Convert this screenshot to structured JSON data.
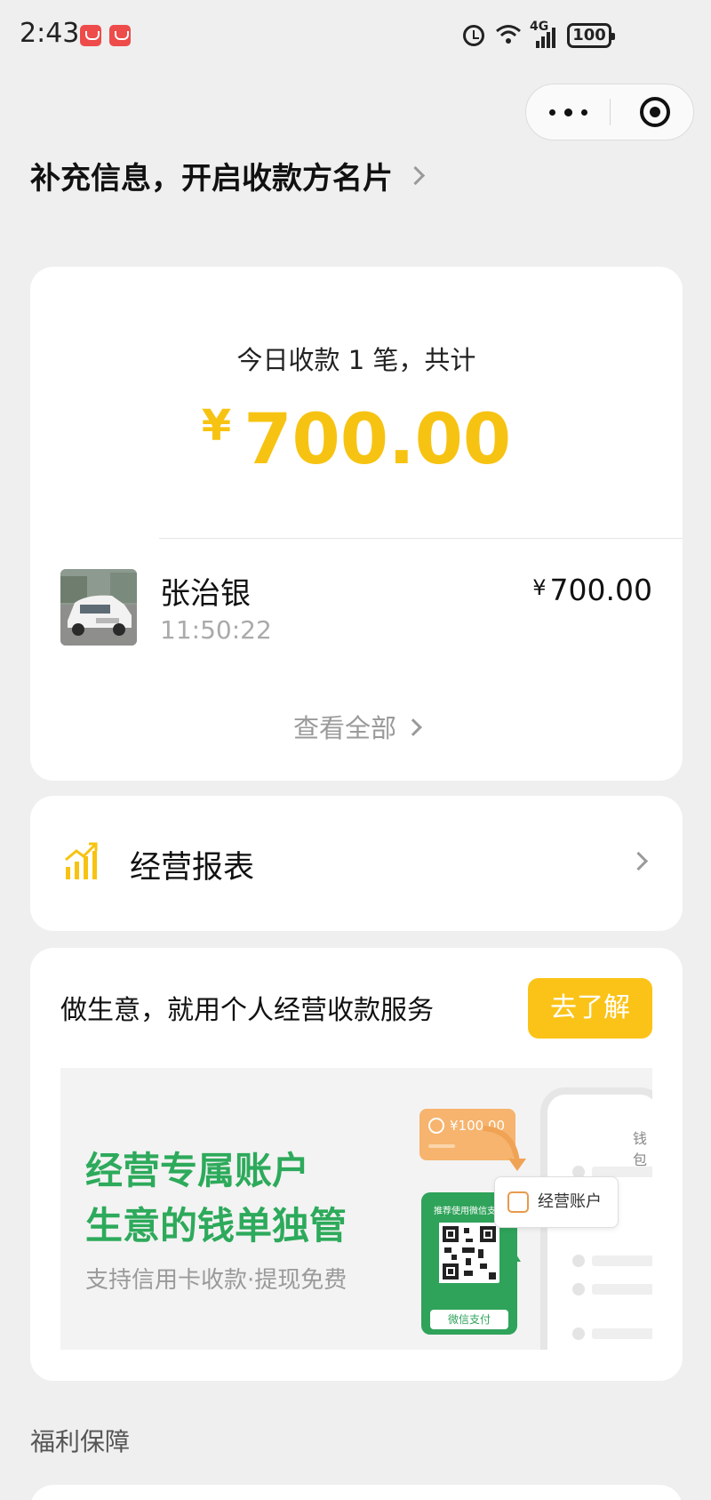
{
  "status_bar": {
    "time": "2:43",
    "network": "4G",
    "battery": "100",
    "icons": [
      "app-notification-icon",
      "app-notification-icon",
      "alarm-icon",
      "wifi-icon",
      "signal-icon",
      "battery-icon"
    ]
  },
  "capsule": {
    "more_icon": "more-dots-icon",
    "close_icon": "target-close-icon"
  },
  "profile_link": {
    "label": "补充信息，开启收款方名片"
  },
  "summary": {
    "line": "今日收款 1 笔，共计",
    "currency": "¥",
    "total": "700.00",
    "accent_color": "#f7c312"
  },
  "transactions": [
    {
      "name": "张治银",
      "time": "11:50:22",
      "currency": "¥",
      "amount": "700.00"
    }
  ],
  "view_all": {
    "label": "查看全部"
  },
  "report": {
    "label": "经营报表",
    "icon": "chart-trend-icon"
  },
  "promo": {
    "title": "做生意，就用个人经营收款服务",
    "button_label": "去了解",
    "button_color": "#fbc317",
    "banner": {
      "headline_1": "经营专属账户",
      "headline_2": "生意的钱单独管",
      "subtitle": "支持信用卡收款·提现免费",
      "headline_color": "#2daa5b",
      "wallet_label": "钱包",
      "orange_card_amount": "¥100.00",
      "qr_card_top": "推荐使用微信支付",
      "qr_card_bottom": "微信支付",
      "biz_tag": "经营账户"
    }
  },
  "section": {
    "title": "福利保障"
  }
}
